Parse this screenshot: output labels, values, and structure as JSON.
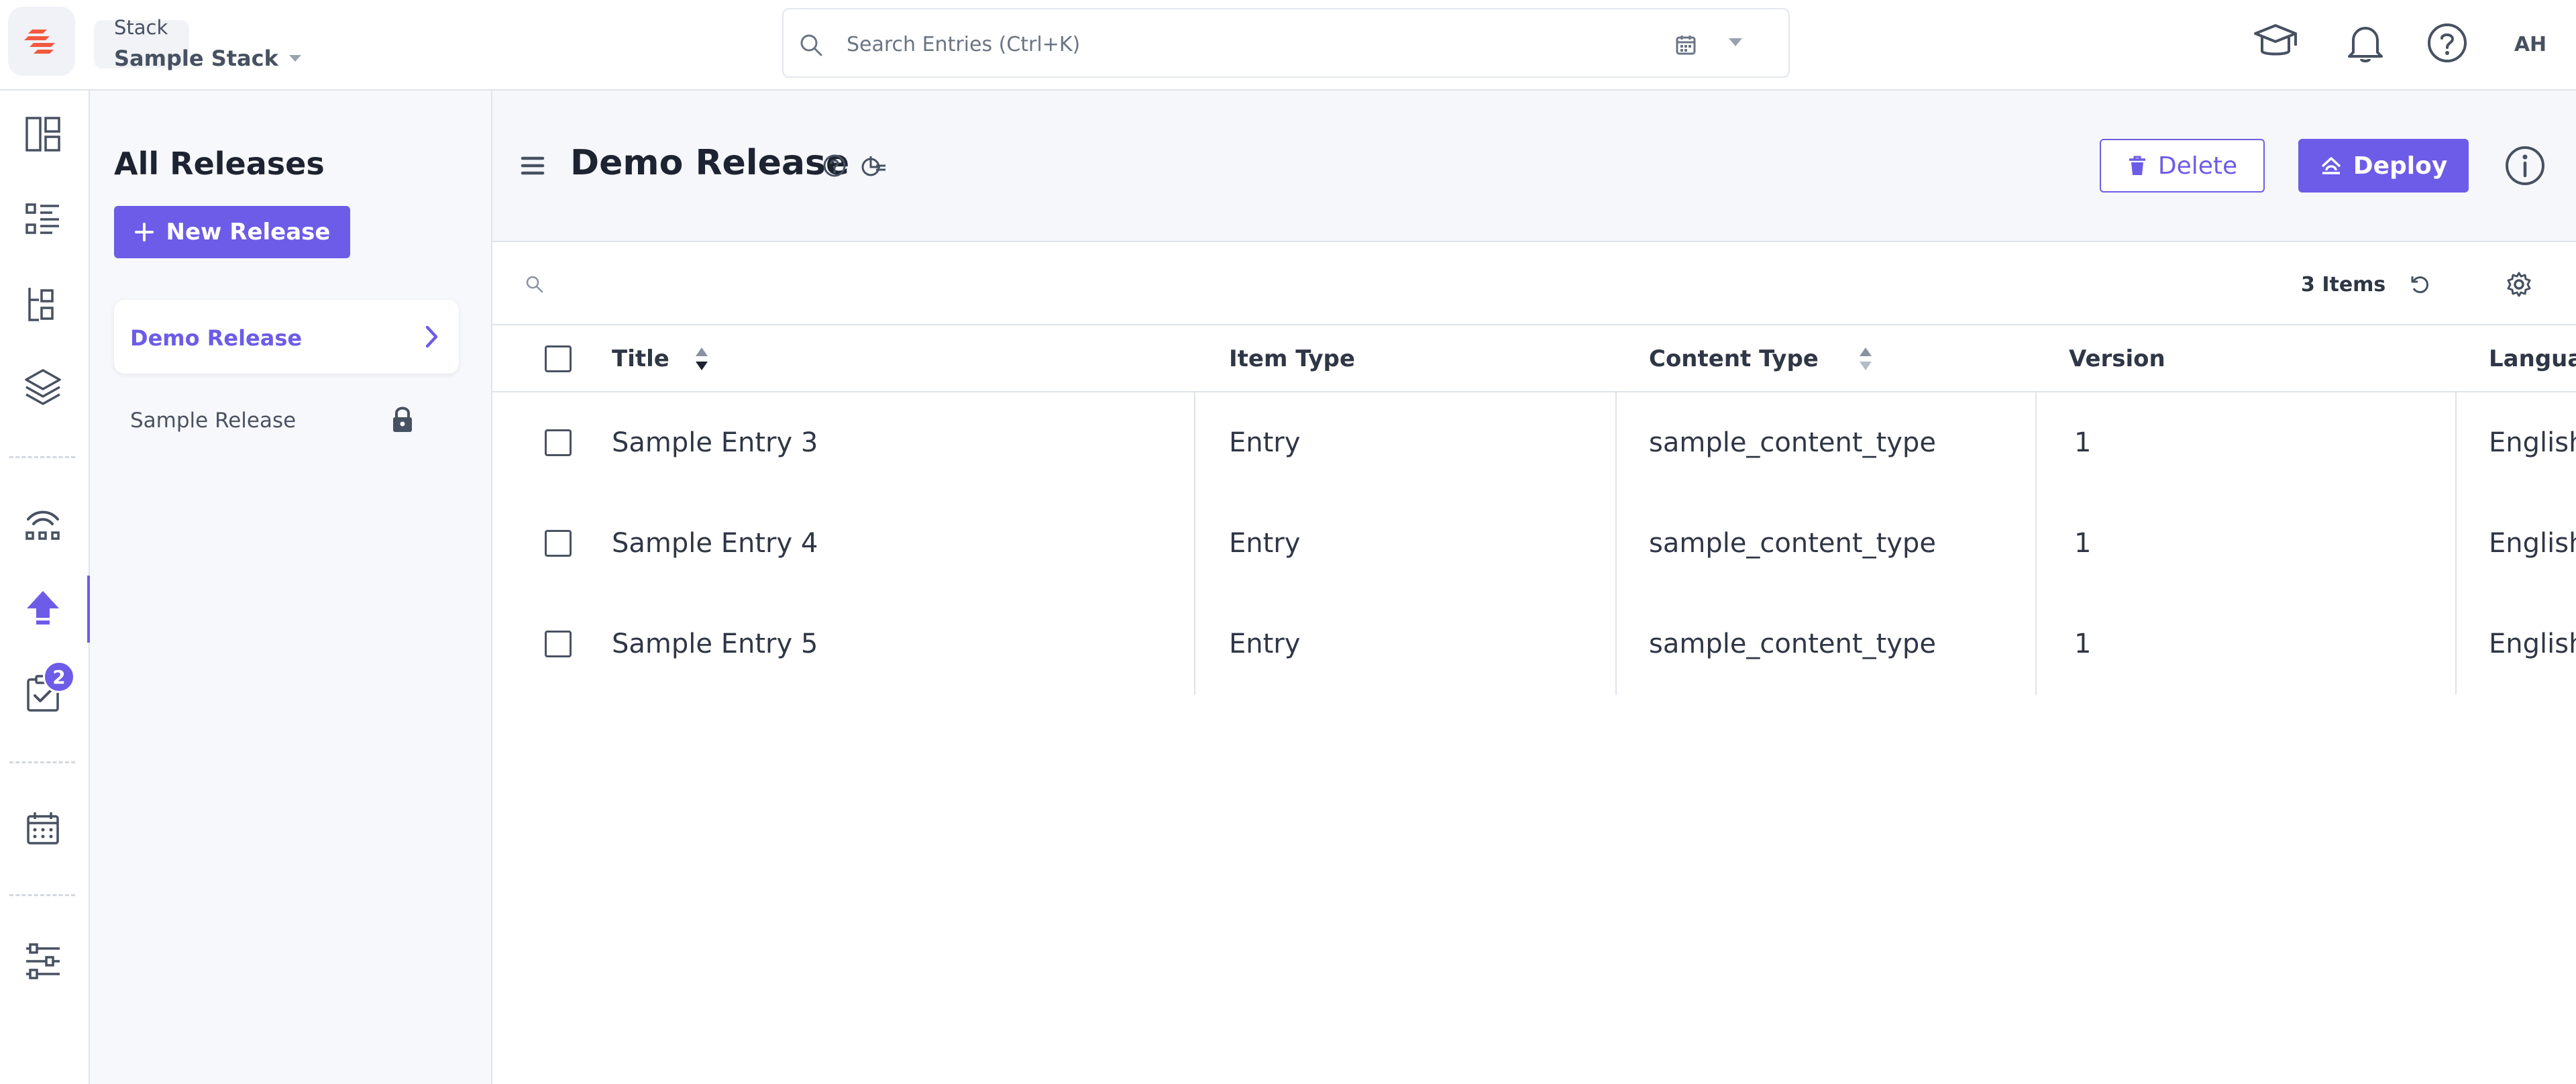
{
  "topbar": {
    "stack_caption": "Stack",
    "stack_name": "Sample Stack",
    "search_placeholder": "Search Entries (Ctrl+K)",
    "avatar_initials": "AH"
  },
  "rail": {
    "badge_count": "2",
    "accent": "#6c5ce7"
  },
  "releases_panel": {
    "title": "All Releases",
    "new_release_label": "New Release",
    "items": [
      {
        "label": "Demo Release",
        "active": true
      },
      {
        "label": "Sample Release",
        "locked": true
      }
    ]
  },
  "main": {
    "release_title": "Demo Release",
    "delete_label": "Delete",
    "deploy_label": "Deploy",
    "items_count": "3 Items"
  },
  "table": {
    "columns": [
      "Title",
      "Item Type",
      "Content Type",
      "Version",
      "Langua"
    ],
    "rows": [
      {
        "title": "Sample Entry 3",
        "item_type": "Entry",
        "content_type": "sample_content_type",
        "version": "1",
        "language": "English"
      },
      {
        "title": "Sample Entry 4",
        "item_type": "Entry",
        "content_type": "sample_content_type",
        "version": "1",
        "language": "English"
      },
      {
        "title": "Sample Entry 5",
        "item_type": "Entry",
        "content_type": "sample_content_type",
        "version": "1",
        "language": "English"
      }
    ]
  },
  "colors": {
    "primary": "#6c5ce7",
    "text_dark": "#1d2330",
    "icon_slate": "#475161",
    "border": "#dfe3ea"
  }
}
